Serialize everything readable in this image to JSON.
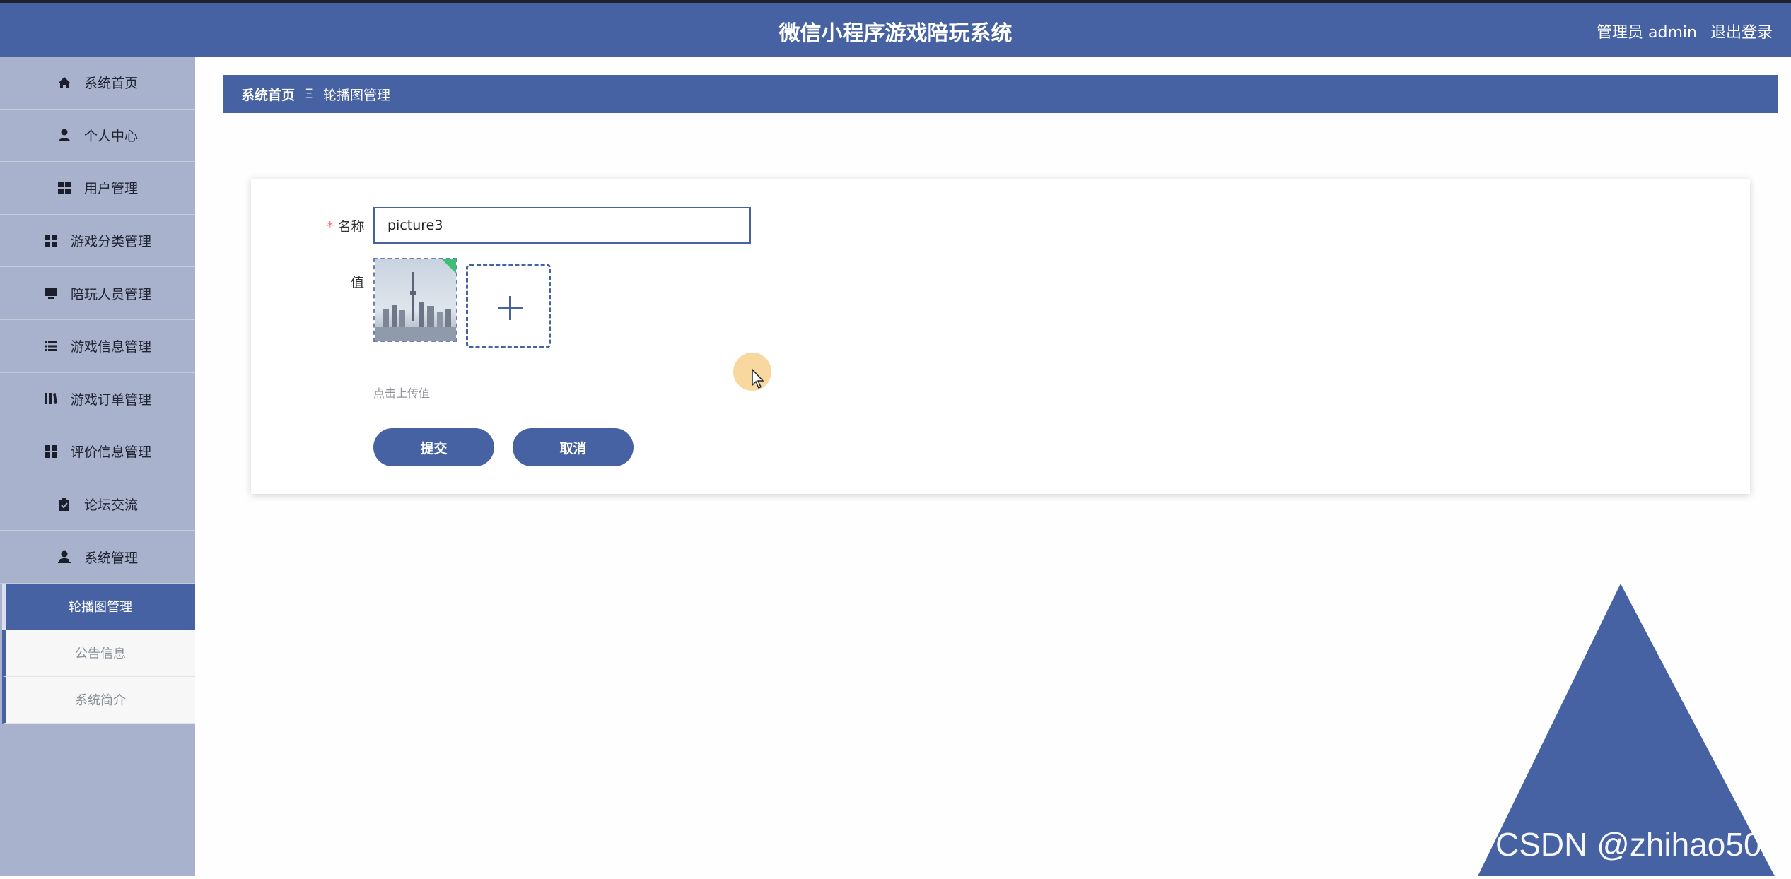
{
  "header": {
    "title": "微信小程序游戏陪玩系统",
    "user_role": "管理员 admin",
    "logout": "退出登录"
  },
  "sidebar": {
    "items": [
      {
        "label": "系统首页",
        "icon": "home-icon"
      },
      {
        "label": "个人中心",
        "icon": "user-icon"
      },
      {
        "label": "用户管理",
        "icon": "grid-icon"
      },
      {
        "label": "游戏分类管理",
        "icon": "grid-icon"
      },
      {
        "label": "陪玩人员管理",
        "icon": "monitor-icon"
      },
      {
        "label": "游戏信息管理",
        "icon": "list-icon"
      },
      {
        "label": "游戏订单管理",
        "icon": "books-icon"
      },
      {
        "label": "评价信息管理",
        "icon": "grid-icon"
      },
      {
        "label": "论坛交流",
        "icon": "clipboard-icon"
      },
      {
        "label": "系统管理",
        "icon": "user-admin-icon"
      }
    ],
    "subitems": [
      {
        "label": "轮播图管理",
        "active": true
      },
      {
        "label": "公告信息",
        "active": false
      },
      {
        "label": "系统简介",
        "active": false
      }
    ]
  },
  "breadcrumb": {
    "home": "系统首页",
    "separator": "Ξ",
    "current": "轮播图管理"
  },
  "form": {
    "name_label": "名称",
    "required_mark": "*",
    "name_value": "picture3",
    "value_label": "值",
    "upload_hint": "点击上传值",
    "submit_label": "提交",
    "cancel_label": "取消"
  },
  "watermark": "CSDN @zhihao502",
  "colors": {
    "primary": "#4662a3",
    "sidebar": "#a9b2cc",
    "success": "#3fbf74",
    "danger": "#f56c6c"
  }
}
